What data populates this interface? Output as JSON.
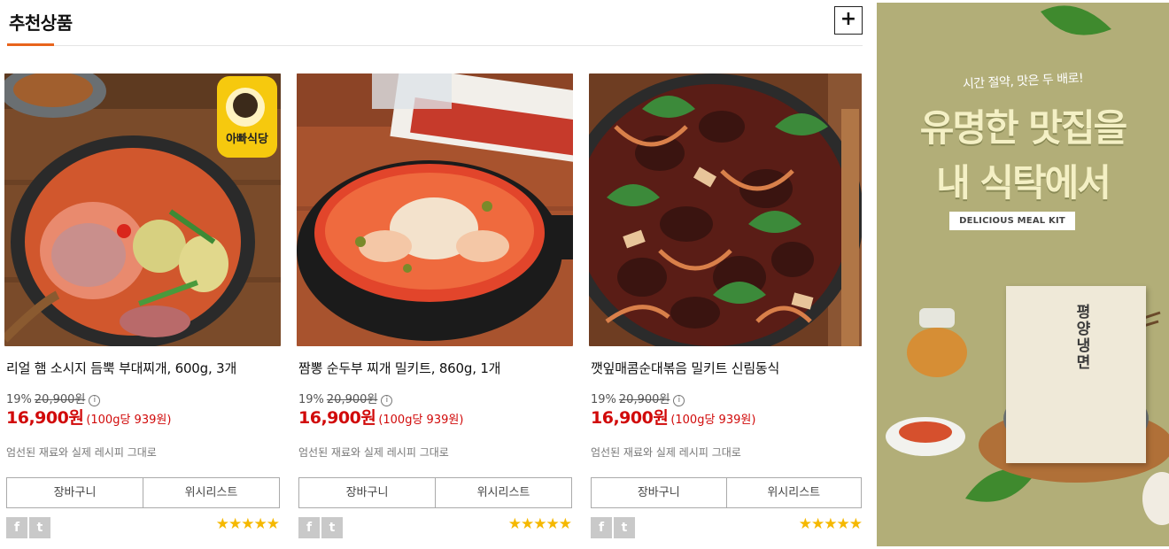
{
  "section": {
    "title": "추천상품",
    "more_label": "+"
  },
  "products": [
    {
      "name": "리얼 햄 소시지 듬뿍 부대찌개, 600g, 3개",
      "discount": "19%",
      "original_price": "20,900원",
      "info_icon": "ⓘ",
      "price": "16,900원",
      "unit_price": "(100g당 939원)",
      "description": "엄선된 재료와 실제 레시피 그대로",
      "cart_label": "장바구니",
      "wishlist_label": "위시리스트",
      "rating": 5,
      "stars": "★★★★★",
      "badge_text": "아빠식당"
    },
    {
      "name": "짬뽕 순두부 찌개 밀키트, 860g, 1개",
      "discount": "19%",
      "original_price": "20,900원",
      "info_icon": "ⓘ",
      "price": "16,900원",
      "unit_price": "(100g당 939원)",
      "description": "엄선된 재료와 실제 레시피 그대로",
      "cart_label": "장바구니",
      "wishlist_label": "위시리스트",
      "rating": 5,
      "stars": "★★★★★"
    },
    {
      "name": "깻잎매콤순대볶음 밀키트 신림동식",
      "discount": "19%",
      "original_price": "20,900원",
      "info_icon": "ⓘ",
      "price": "16,900원",
      "unit_price": "(100g당 939원)",
      "description": "엄선된 재료와 실제 레시피 그대로",
      "cart_label": "장바구니",
      "wishlist_label": "위시리스트",
      "rating": 5,
      "stars": "★★★★★"
    }
  ],
  "social": {
    "facebook_glyph": "f",
    "twitter_glyph": "t"
  },
  "banner": {
    "tagline": "시간 절약, 맛은 두 배로!",
    "headline_line1": "유명한 맛집을",
    "headline_line2": "내 식탁에서",
    "kit_label": "DELICIOUS MEAL KIT",
    "package_title": "평양냉면"
  },
  "colors": {
    "accent": "#e8641c",
    "price": "#d10a0a",
    "star": "#f5b800",
    "banner_bg": "#b2ae78"
  }
}
